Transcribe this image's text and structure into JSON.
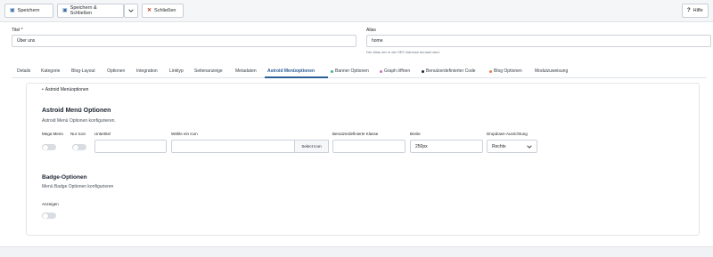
{
  "toolbar": {
    "save_label": "Speichern",
    "save_close_label": "Speichern & Schließen",
    "close_label": "Schließen",
    "help_label": "Hilfe"
  },
  "form": {
    "title_label": "Titel *",
    "title_value": "Über uns",
    "alias_label": "Alias",
    "alias_value": "home",
    "alias_hint": "Der Alias der in der SEF-Adresse benutzt wird."
  },
  "tabs": [
    {
      "label": "Details"
    },
    {
      "label": "Kategorie"
    },
    {
      "label": "Blog-Layout"
    },
    {
      "label": "Optionen"
    },
    {
      "label": "Integration"
    },
    {
      "label": "Linktyp"
    },
    {
      "label": "Seitenanzeige"
    },
    {
      "label": "Metadaten"
    },
    {
      "label": "Astroid Menüoptionen"
    },
    {
      "label": "Banner Optionen",
      "dot": "#3bb39b"
    },
    {
      "label": "Graph öffnen",
      "dot": "#d06fc2"
    },
    {
      "label": "Benutzerdefinierter Code",
      "dot": "#22262a"
    },
    {
      "label": "Blog Optionen",
      "dot": "#e87a4e"
    },
    {
      "label": "Modulzuweisung"
    }
  ],
  "panel": {
    "legend": "Astroid Menüoptionen",
    "menu_section": {
      "title": "Astroid Menü Optionen",
      "desc": "Astroid Menü Optionen konfigurieren.",
      "col_mega": "Mega Menü",
      "col_icon_only": "Nur Icon",
      "col_subtitle": "Untertitel",
      "col_icon": "Wähle ein Icon",
      "col_class": "Benutzerdefinierte Klasse",
      "col_width": "Breite",
      "col_dropdown": "Dropdown-Ausrichtung",
      "select_icon_label": "Select Icon",
      "width_value": "250px",
      "dropdown_value": "Rechts"
    },
    "badge_section": {
      "title": "Badge-Optionen",
      "desc": "Menü Badge Optionen konfigurieren",
      "show_label": "Anzeigen"
    }
  },
  "colors": {
    "accent": "#2a5e96",
    "toolbar_bg": "#f5f6f8",
    "toggle_off": "#d9dde2"
  }
}
